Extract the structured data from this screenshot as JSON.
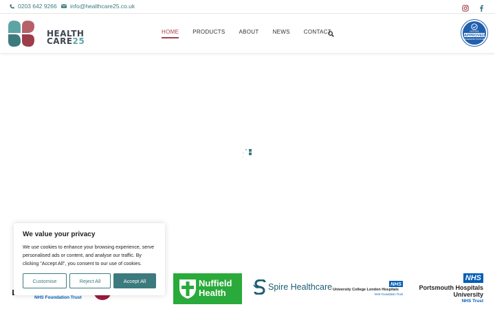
{
  "topbar": {
    "phone": "0203 642 9266",
    "email": "info@healthcare25.co.uk",
    "social": [
      "instagram-icon",
      "facebook-icon"
    ]
  },
  "logo": {
    "line1": "HEALTH",
    "line2": "CARE",
    "line2_num": "25"
  },
  "nav": {
    "items": [
      {
        "label": "HOME",
        "active": true
      },
      {
        "label": "PRODUCTS",
        "active": false
      },
      {
        "label": "ABOUT",
        "active": false
      },
      {
        "label": "NEWS",
        "active": false
      },
      {
        "label": "CONTACT",
        "active": false
      }
    ],
    "search_icon": "search-icon"
  },
  "badge": {
    "line1": "NHS-SBS",
    "line2": "APPROVED",
    "line3": "FRAMEWORK SUPPLIER"
  },
  "cookie": {
    "title": "We value your privacy",
    "description": "We use cookies to enhance your browsing experience, serve personalised ads or content, and analyse our traffic. By clicking \"Accept All\", you consent to our use of cookies.",
    "customise": "Customise",
    "reject": "Reject All",
    "accept": "Accept All"
  },
  "partners": {
    "partial_trust": "NHS Foundation Trust",
    "nuffield": {
      "line1": "Nuffield",
      "line2": "Health"
    },
    "spire": "Spire Healthcare",
    "uclh": {
      "nhs": "NHS",
      "name": "University College London Hospitals",
      "trust": "NHS Foundation Trust"
    },
    "portsmouth": {
      "nhs": "NHS",
      "line1": "Portsmouth Hospitals",
      "line2": "University",
      "trust": "NHS Trust"
    }
  },
  "colors": {
    "teal": "#3c7a7e",
    "maroon": "#a3414b",
    "nuffield_green": "#2aaa3a",
    "nhs_blue": "#005eb8"
  }
}
